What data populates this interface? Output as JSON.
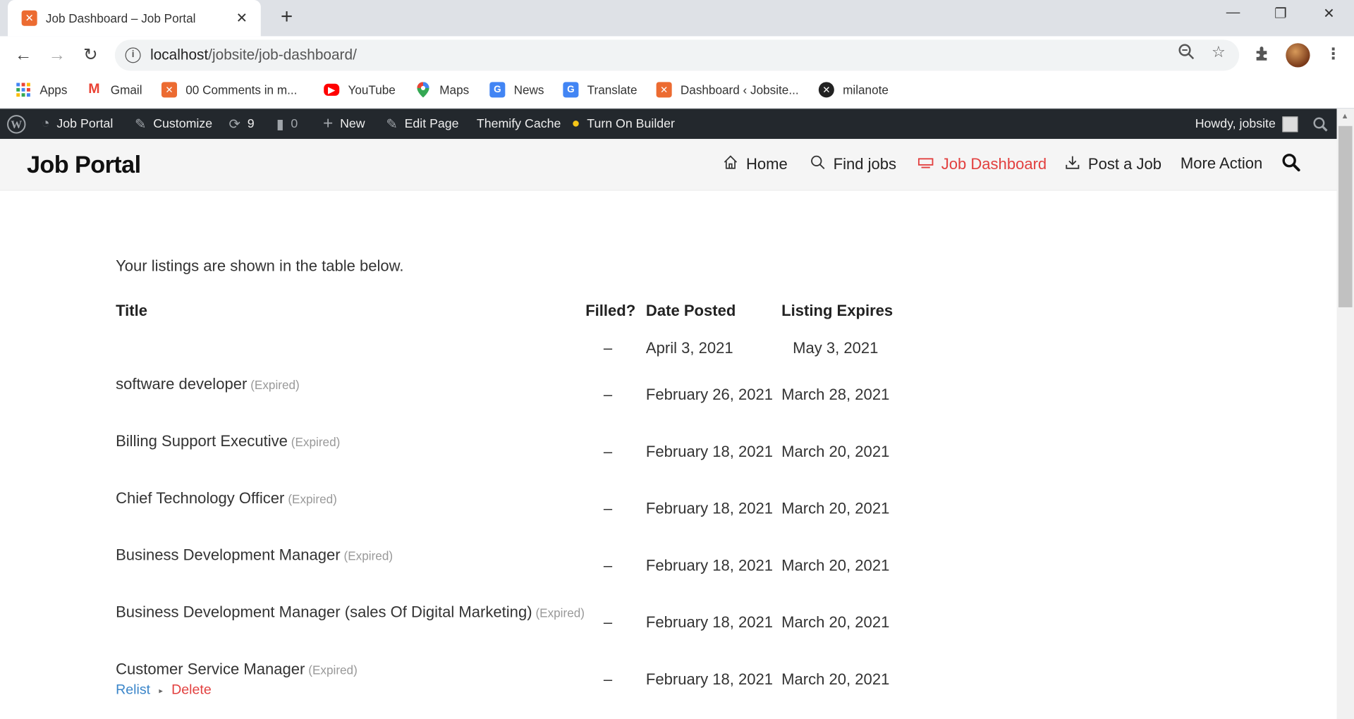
{
  "browser": {
    "tab_title": "Job Dashboard – Job Portal",
    "tab_close": "✕",
    "new_tab": "+",
    "url_host": "localhost",
    "url_path": "/jobsite/job-dashboard/",
    "window_controls": {
      "minimize": "—",
      "restore": "❐",
      "close": "✕"
    }
  },
  "bookmarks": [
    {
      "label": "Apps",
      "icon": "apps-grid-icon"
    },
    {
      "label": "Gmail",
      "icon": "gmail-icon"
    },
    {
      "label": "00 Comments in m...",
      "icon": "xampp-icon"
    },
    {
      "label": "YouTube",
      "icon": "youtube-icon"
    },
    {
      "label": "Maps",
      "icon": "maps-icon"
    },
    {
      "label": "News",
      "icon": "news-icon"
    },
    {
      "label": "Translate",
      "icon": "translate-icon"
    },
    {
      "label": "Dashboard ‹ Jobsite...",
      "icon": "xampp-icon"
    },
    {
      "label": "milanote",
      "icon": "milanote-icon"
    }
  ],
  "admin_bar": {
    "site_name": "Job Portal",
    "customize": "Customize",
    "updates_count": "9",
    "comments_count": "0",
    "new": "New",
    "edit_page": "Edit Page",
    "themify_cache": "Themify Cache",
    "turn_on_builder": "Turn On Builder",
    "howdy": "Howdy, jobsite"
  },
  "site": {
    "title": "Job Portal",
    "menu": [
      {
        "label": "Home",
        "icon": "home-icon",
        "active": false
      },
      {
        "label": "Find jobs",
        "icon": "search-icon",
        "active": false
      },
      {
        "label": "Job Dashboard",
        "icon": "dashboard-icon",
        "active": true
      },
      {
        "label": "Post a Job",
        "icon": "download-icon",
        "active": false
      },
      {
        "label": "More Action",
        "icon": "",
        "active": false
      }
    ]
  },
  "dashboard": {
    "intro": "Your listings are shown in the table below.",
    "columns": [
      "Title",
      "Filled?",
      "Date Posted",
      "Listing Expires"
    ],
    "rows": [
      {
        "title": "",
        "status": "",
        "filled": "–",
        "date_posted": "April 3, 2021",
        "expires": "May 3, 2021"
      },
      {
        "title": "software developer",
        "status": "(Expired)",
        "filled": "–",
        "date_posted": "February 26, 2021",
        "expires": "March 28, 2021"
      },
      {
        "title": "Billing Support Executive",
        "status": "(Expired)",
        "filled": "–",
        "date_posted": "February 18, 2021",
        "expires": "March 20, 2021"
      },
      {
        "title": "Chief Technology Officer",
        "status": "(Expired)",
        "filled": "–",
        "date_posted": "February 18, 2021",
        "expires": "March 20, 2021"
      },
      {
        "title": "Business Development Manager",
        "status": "(Expired)",
        "filled": "–",
        "date_posted": "February 18, 2021",
        "expires": "March 20, 2021"
      },
      {
        "title": "Business Development Manager (sales Of Digital Marketing)",
        "status": "(Expired)",
        "filled": "–",
        "date_posted": "February 18, 2021",
        "expires": "March 20, 2021"
      },
      {
        "title": "Customer Service Manager",
        "status": "(Expired)",
        "filled": "–",
        "date_posted": "February 18, 2021",
        "expires": "March 20, 2021"
      }
    ],
    "actions": {
      "relist": "Relist",
      "separator": "▸",
      "delete": "Delete"
    }
  }
}
